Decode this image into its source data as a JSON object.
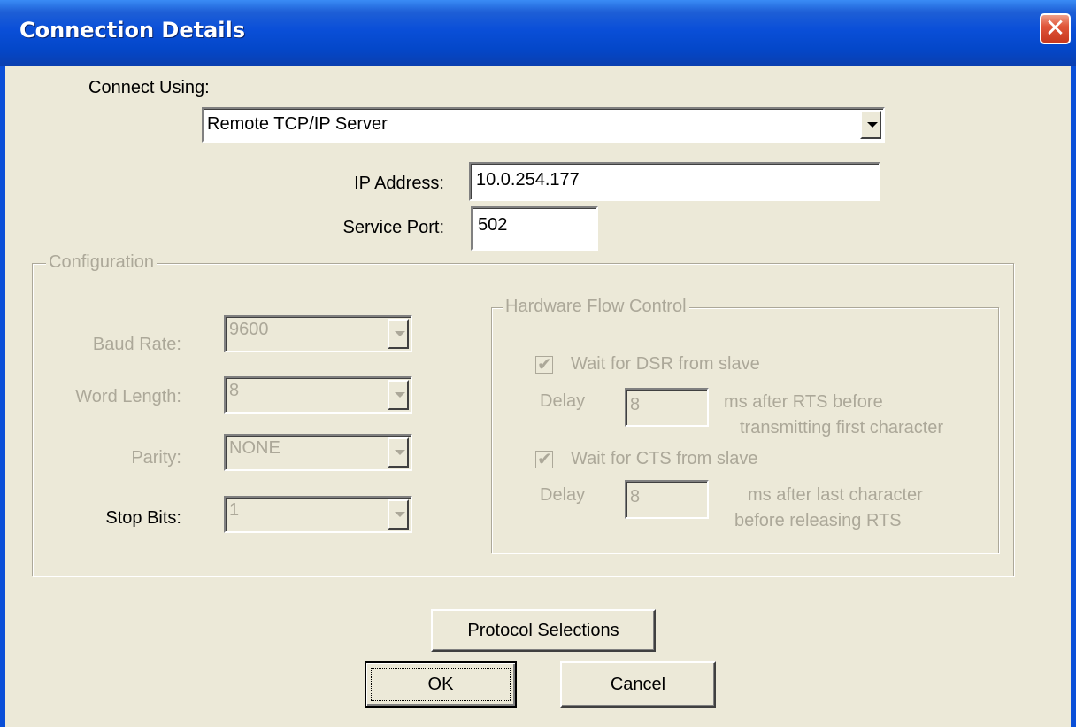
{
  "window": {
    "title": "Connection Details"
  },
  "connect_using": {
    "label": "Connect Using:",
    "selected": "Remote TCP/IP Server"
  },
  "ip_address": {
    "label": "IP Address:",
    "value": "10.0.254.177"
  },
  "service_port": {
    "label": "Service Port:",
    "value": "502"
  },
  "configuration": {
    "legend": "Configuration",
    "baud_rate": {
      "label": "Baud Rate:",
      "value": "9600"
    },
    "word_length": {
      "label": "Word Length:",
      "value": "8"
    },
    "parity": {
      "label": "Parity:",
      "value": "NONE"
    },
    "stop_bits": {
      "label": "Stop Bits:",
      "value": "1"
    }
  },
  "hardware_flow": {
    "legend": "Hardware Flow Control",
    "dsr": {
      "checkbox_label": "Wait for DSR from slave",
      "checked": true,
      "delay_label": "Delay",
      "delay_value": "8",
      "desc_line1": "ms after RTS before",
      "desc_line2": "transmitting first character"
    },
    "cts": {
      "checkbox_label": "Wait for CTS from slave",
      "checked": true,
      "delay_label": "Delay",
      "delay_value": "8",
      "desc_line1": "ms after last character",
      "desc_line2": "before releasing RTS"
    }
  },
  "buttons": {
    "protocol": "Protocol Selections",
    "ok": "OK",
    "cancel": "Cancel"
  },
  "colors": {
    "titlebar": "#0A4FD8",
    "dialog_bg": "#ECE9D8",
    "disabled_text": "#ACA899",
    "close_button": "#E0563A"
  }
}
